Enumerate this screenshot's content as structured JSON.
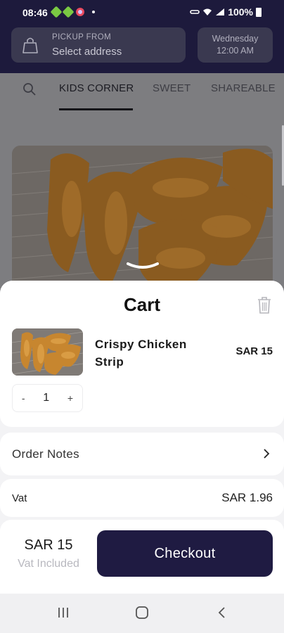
{
  "status_bar": {
    "time": "08:46",
    "battery": "100%"
  },
  "header": {
    "pickup_label": "PICKUP FROM",
    "pickup_value": "Select address",
    "day": "Wednesday",
    "time": "12:00 AM"
  },
  "tabs": {
    "items": [
      "KIDS CORNER",
      "SWEET",
      "SHAREABLE"
    ],
    "active": "KIDS CORNER"
  },
  "cart": {
    "title": "Cart",
    "item": {
      "name": "Crispy Chicken Strip",
      "price": "SAR 15",
      "quantity": "1",
      "minus": "-",
      "plus": "+"
    },
    "order_notes_label": "Order Notes",
    "vat_label": "Vat",
    "vat_value": "SAR 1.96",
    "total": "SAR 15",
    "total_note": "Vat Included",
    "checkout_label": "Checkout"
  },
  "colors": {
    "brand_dark": "#1f1b42",
    "header_bg": "#1d1a3c"
  },
  "icons": [
    "bag-icon",
    "search-icon",
    "trash-icon",
    "chevron-right-icon",
    "chevron-down-icon",
    "recents-icon",
    "home-icon",
    "back-icon"
  ]
}
